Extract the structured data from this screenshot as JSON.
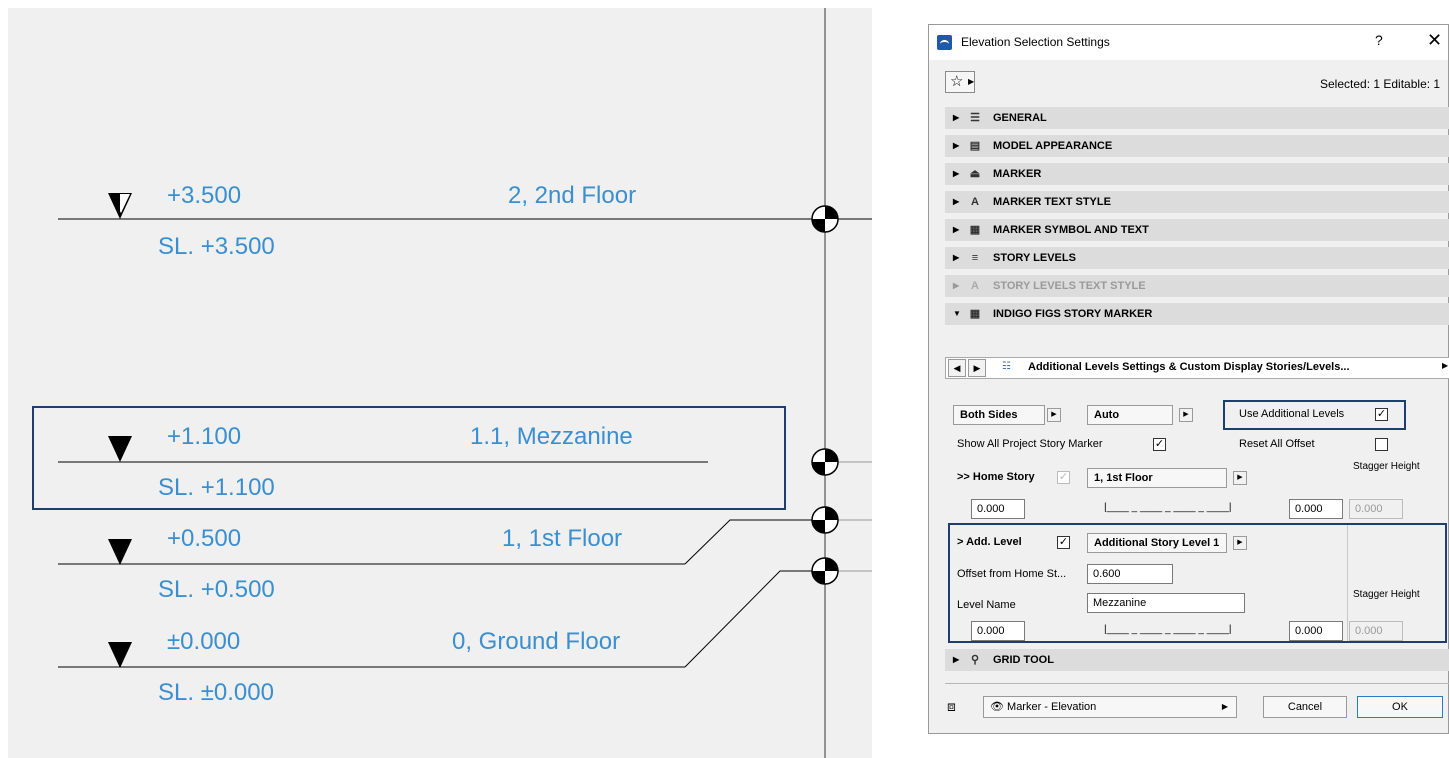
{
  "canvas": {
    "levels": [
      {
        "elev": "+3.500",
        "story": "2,  2nd Floor",
        "sl": "SL. +3.500"
      },
      {
        "elev": "+1.100",
        "story": "1.1,  Mezzanine",
        "sl": "SL. +1.100"
      },
      {
        "elev": "+0.500",
        "story": "1,  1st Floor",
        "sl": "SL. +0.500"
      },
      {
        "elev": "±0.000",
        "story": "0,  Ground Floor",
        "sl": "SL. ±0.000"
      }
    ]
  },
  "dialog": {
    "title": "Elevation Selection Settings",
    "help": "?",
    "close": "✕",
    "selected_info": "Selected: 1 Editable: 1",
    "panels": [
      {
        "label": "GENERAL",
        "icon": "general-icon"
      },
      {
        "label": "MODEL APPEARANCE",
        "icon": "model-appearance-icon"
      },
      {
        "label": "MARKER",
        "icon": "marker-icon"
      },
      {
        "label": "MARKER TEXT STYLE",
        "icon": "text-style-icon"
      },
      {
        "label": "MARKER SYMBOL AND TEXT",
        "icon": "symbol-text-icon"
      },
      {
        "label": "STORY LEVELS",
        "icon": "story-levels-icon"
      },
      {
        "label": "STORY LEVELS TEXT STYLE",
        "icon": "text-style-icon"
      },
      {
        "label": "INDIGO FIGS STORY MARKER",
        "icon": "symbol-text-icon"
      }
    ],
    "subpanel_label": "Additional Levels Settings & Custom Display Stories/Levels...",
    "both_sides": "Both Sides",
    "auto": "Auto",
    "use_additional_levels": "Use Additional Levels",
    "show_all_marker": "Show All Project Story Marker",
    "reset_all_offset": "Reset All Offset",
    "home_story_label": ">> Home Story",
    "home_story_value": "1, 1st Floor",
    "stagger_height": "Stagger Height",
    "home_left_value": "0.000",
    "home_right_value": "0.000",
    "home_stagger_value": "0.000",
    "dashes": "|____ _ ____ _ ____ _ ____|",
    "add_level_label": "> Add. Level",
    "add_level_value": "Additional Story Level 1",
    "offset_label": "Offset from Home St...",
    "offset_value": "0.600",
    "level_name_label": "Level Name",
    "level_name_value": "Mezzanine",
    "add_left_value": "0.000",
    "add_right_value": "0.000",
    "add_stagger_value": "0.000",
    "grid_tool": "GRID TOOL",
    "footer_layer": "Marker - Elevation",
    "cancel": "Cancel",
    "ok": "OK"
  }
}
